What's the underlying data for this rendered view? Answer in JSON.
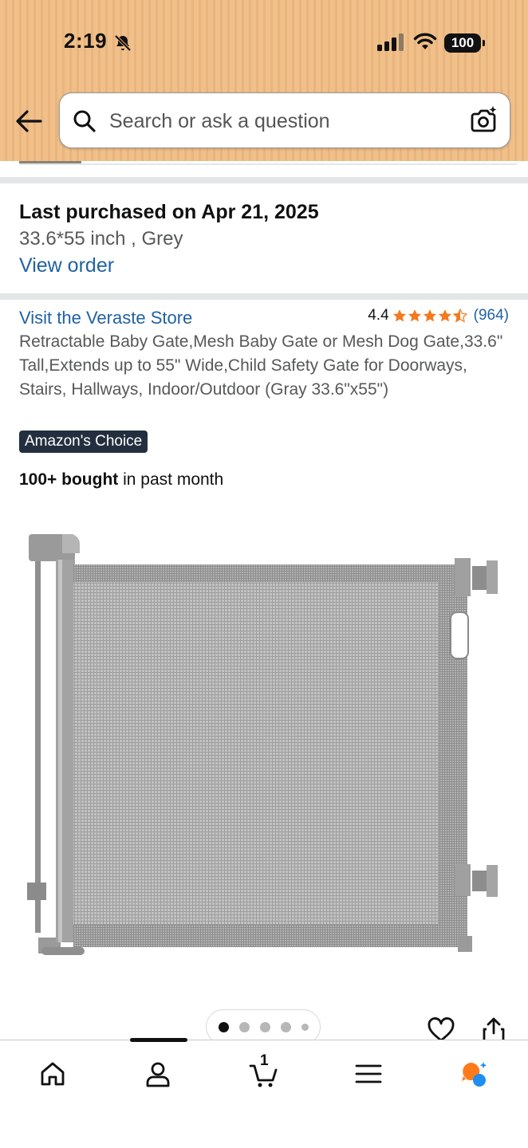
{
  "status_bar": {
    "time": "2:19",
    "battery": "100",
    "icons": [
      "bell-muted-icon",
      "cellular-signal-icon",
      "wifi-icon",
      "battery-icon"
    ]
  },
  "search": {
    "placeholder": "Search or ask a question",
    "icons": [
      "back-arrow-icon",
      "search-icon",
      "camera-lens-icon"
    ]
  },
  "purchase": {
    "last_purchased": "Last purchased on Apr 21, 2025",
    "variant": "33.6*55 inch , Grey",
    "view_order": "View order"
  },
  "product": {
    "store_link": "Visit the Veraste Store",
    "rating": "4.4",
    "rating_value": 4.4,
    "rating_count": "(964)",
    "title": "Retractable Baby Gate,Mesh Baby Gate or Mesh Dog Gate,33.6\" Tall,Extends up to 55\" Wide,Child Safety Gate for Doorways, Stairs, Hallways, Indoor/Outdoor (Gray 33.6\"x55\")",
    "badge": "Amazon's Choice",
    "bought_strong": "100+ bought",
    "bought_rest": " in past month",
    "image_count": 5,
    "active_image": 1
  },
  "bottom_nav": {
    "items": [
      "home-icon",
      "account-icon",
      "cart-icon",
      "menu-icon",
      "rufus-icon"
    ],
    "cart_count": "1"
  },
  "colors": {
    "header_bg": "#f0c08a",
    "link": "#2162a1",
    "star": "#f47a1f",
    "badge_bg": "#232f3e",
    "rufus_orange": "#ff7a1a",
    "rufus_blue": "#1f8ef1"
  }
}
